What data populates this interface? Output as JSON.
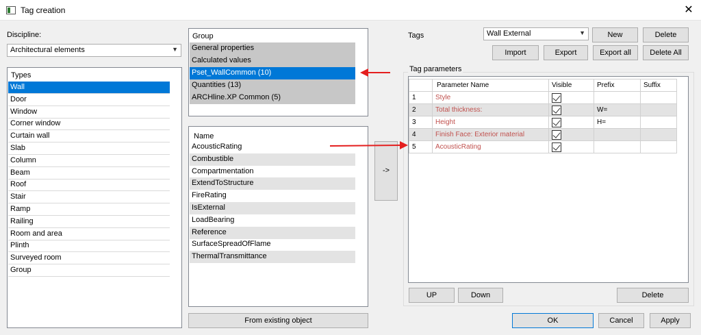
{
  "window": {
    "title": "Tag creation",
    "close_label": "✕"
  },
  "discipline": {
    "label": "Discipline:",
    "value": "Architectural elements"
  },
  "types": {
    "header": "Types",
    "items": [
      "Wall",
      "Door",
      "Window",
      "Corner window",
      "Curtain wall",
      "Slab",
      "Column",
      "Beam",
      "Roof",
      "Stair",
      "Ramp",
      "Railing",
      "Room and area",
      "Plinth",
      "Surveyed room",
      "Group"
    ]
  },
  "group_list": {
    "header": "Group",
    "items": [
      "General properties",
      "Calculated values",
      "Pset_WallCommon (10)",
      "Quantities (13)",
      "ARCHline.XP Common (5)"
    ]
  },
  "name_list": {
    "header": "Name",
    "items": [
      "AcousticRating",
      "Combustible",
      "Compartmentation",
      "ExtendToStructure",
      "FireRating",
      "IsExternal",
      "LoadBearing",
      "Reference",
      "SurfaceSpreadOfFlame",
      "ThermalTransmittance"
    ]
  },
  "buttons": {
    "add_arrow": "->",
    "from_existing": "From existing object",
    "new": "New",
    "delete": "Delete",
    "import": "Import",
    "export": "Export",
    "export_all": "Export all",
    "delete_all": "Delete All",
    "up": "UP",
    "down": "Down",
    "delete_param": "Delete",
    "ok": "OK",
    "cancel": "Cancel",
    "apply": "Apply"
  },
  "tags": {
    "label": "Tags",
    "value": "Wall External"
  },
  "tag_parameters": {
    "label": "Tag parameters",
    "columns": [
      "",
      "Parameter Name",
      "Visible",
      "Prefix",
      "Suffix"
    ],
    "rows": [
      {
        "num": "1",
        "name": "Style",
        "visible": true,
        "prefix": "",
        "suffix": ""
      },
      {
        "num": "2",
        "name": "Total thickness:",
        "visible": true,
        "prefix": "W=",
        "suffix": ""
      },
      {
        "num": "3",
        "name": "Height",
        "visible": true,
        "prefix": "H=",
        "suffix": ""
      },
      {
        "num": "4",
        "name": "Finish Face: Exterior material",
        "visible": true,
        "prefix": "",
        "suffix": ""
      },
      {
        "num": "5",
        "name": "AcousticRating",
        "visible": true,
        "prefix": "",
        "suffix": ""
      }
    ]
  },
  "colors": {
    "selection": "#0078d7",
    "annotation_arrow": "#e41e1e",
    "param_text": "#c0504d"
  }
}
